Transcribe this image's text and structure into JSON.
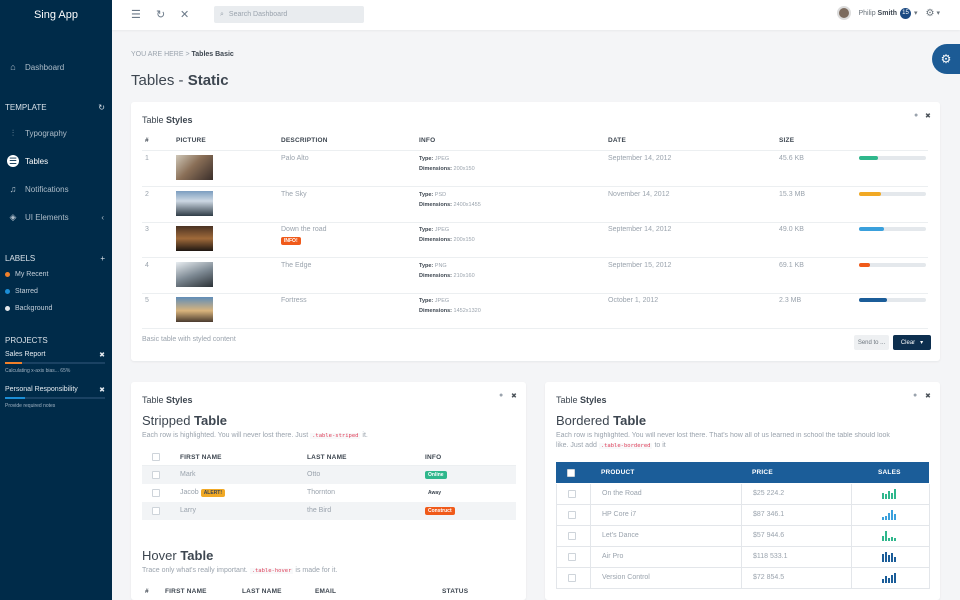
{
  "app": {
    "brand": "Sing App"
  },
  "sidebar": {
    "nav": [
      {
        "label": "Dashboard",
        "icon": "home-icon"
      },
      {
        "label": "Typography",
        "icon": "typography-icon"
      },
      {
        "label": "Tables",
        "icon": "grid-icon"
      },
      {
        "label": "Notifications",
        "icon": "bell-icon"
      },
      {
        "label": "UI Elements",
        "icon": "layers-icon"
      }
    ],
    "template_label": "TEMPLATE",
    "labels_label": "LABELS",
    "labels": [
      {
        "label": "My Recent",
        "color": "#f0802a"
      },
      {
        "label": "Starred",
        "color": "#1c8ed6"
      },
      {
        "label": "Background",
        "color": "#e5e9ec"
      }
    ],
    "projects_label": "PROJECTS",
    "projects": [
      {
        "title": "Sales Report",
        "note": "Calculating x-axis bias... 65%",
        "color": "#f0802a",
        "progress": 0.17
      },
      {
        "title": "Personal Responsibility",
        "note": "Provide required notes",
        "color": "#1c8ed6",
        "progress": 0.2
      }
    ]
  },
  "topbar": {
    "search_placeholder": "Search Dashboard",
    "user_first": "Philip",
    "user_last": "Smith",
    "badge": "15"
  },
  "breadcrumb": {
    "prefix": "YOU ARE HERE",
    "sep": ">",
    "current": "Tables Basic"
  },
  "page": {
    "title_light": "Tables -",
    "title_bold": "Static"
  },
  "table1": {
    "title_light": "Table",
    "title_bold": "Styles",
    "headers": [
      "#",
      "PICTURE",
      "DESCRIPTION",
      "INFO",
      "DATE",
      "SIZE"
    ],
    "rows": [
      {
        "num": "1",
        "desc": "Palo Alto",
        "type_label": "Type:",
        "type": "JPEG",
        "dim_label": "Dimensions:",
        "dim": "200x150",
        "date": "September 14, 2012",
        "size": "45.6 KB",
        "progress": 0.28,
        "color": "#2fb78c",
        "tag": ""
      },
      {
        "num": "2",
        "desc": "The Sky",
        "type_label": "Type:",
        "type": "PSD",
        "dim_label": "Dimensions:",
        "dim": "2400x1455",
        "date": "November 14, 2012",
        "size": "15.3 MB",
        "progress": 0.33,
        "color": "#f1a925",
        "tag": ""
      },
      {
        "num": "3",
        "desc": "Down the road",
        "type_label": "Type:",
        "type": "JPEG",
        "dim_label": "Dimensions:",
        "dim": "200x150",
        "date": "September 14, 2012",
        "size": "49.0 KB",
        "progress": 0.38,
        "color": "#3aa0dc",
        "tag": "INFO!"
      },
      {
        "num": "4",
        "desc": "The Edge",
        "type_label": "Type:",
        "type": "PNG",
        "dim_label": "Dimensions:",
        "dim": "210x160",
        "date": "September 15, 2012",
        "size": "69.1 KB",
        "progress": 0.17,
        "color": "#f05a1a",
        "tag": ""
      },
      {
        "num": "5",
        "desc": "Fortress",
        "type_label": "Type:",
        "type": "JPEG",
        "dim_label": "Dimensions:",
        "dim": "1452x1320",
        "date": "October 1, 2012",
        "size": "2.3 MB",
        "progress": 0.42,
        "color": "#1b5d99",
        "tag": ""
      }
    ],
    "footer": "Basic table with styled content",
    "send_label": "Send to ...",
    "clear_label": "Clear"
  },
  "striped": {
    "card_title_light": "Table",
    "card_title_bold": "Styles",
    "h_light": "Stripped",
    "h_bold": "Table",
    "desc_pre": "Each row is highlighted. You will never lost there. Just",
    "desc_code": ".table-striped",
    "desc_post": "it.",
    "headers": [
      "FIRST NAME",
      "LAST NAME",
      "INFO"
    ],
    "rows": [
      {
        "first": "Mark",
        "alert": "",
        "last": "Otto",
        "info": "Online",
        "color": "#2fb78c"
      },
      {
        "first": "Jacob",
        "alert": "ALERT!",
        "last": "Thornton",
        "info": "Away",
        "color": "#ffffff"
      },
      {
        "first": "Larry",
        "alert": "",
        "last": "the Bird",
        "info": "Construct",
        "color": "#f05a1a"
      }
    ]
  },
  "hover": {
    "h_light": "Hover",
    "h_bold": "Table",
    "desc_pre": "Trace only what's really important.",
    "desc_code": ".table-hover",
    "desc_post": "is made for it.",
    "headers": [
      "#",
      "FIRST NAME",
      "LAST NAME",
      "EMAIL",
      "STATUS"
    ]
  },
  "bordered": {
    "card_title_light": "Table",
    "card_title_bold": "Styles",
    "h_light": "Bordered",
    "h_bold": "Table",
    "desc1": "Each row is highlighted. You will never lost there. That's how all of us learned in school the table should look",
    "desc2_pre": "like. Just add",
    "desc2_code": ".table-bordered",
    "desc2_post": "to it",
    "headers": [
      "PRODUCT",
      "PRICE",
      "SALES"
    ],
    "rows": [
      {
        "product": "On the Road",
        "price": "$25 224.2",
        "color": "#2fb78c",
        "bars": [
          0.6,
          0.5,
          0.8,
          0.6,
          1.0
        ]
      },
      {
        "product": "HP Core i7",
        "price": "$87 346.1",
        "color": "#3aa0dc",
        "bars": [
          0.3,
          0.4,
          0.7,
          1.0,
          0.6
        ]
      },
      {
        "product": "Let's Dance",
        "price": "$57 944.6",
        "color": "#2fb78c",
        "bars": [
          0.5,
          1.0,
          0.3,
          0.4,
          0.3
        ]
      },
      {
        "product": "Air Pro",
        "price": "$118 533.1",
        "color": "#1b5d99",
        "bars": [
          0.8,
          1.0,
          0.7,
          0.9,
          0.5
        ]
      },
      {
        "product": "Version Control",
        "price": "$72 854.5",
        "color": "#1b5d99",
        "bars": [
          0.4,
          0.7,
          0.5,
          0.8,
          1.0
        ]
      }
    ]
  }
}
